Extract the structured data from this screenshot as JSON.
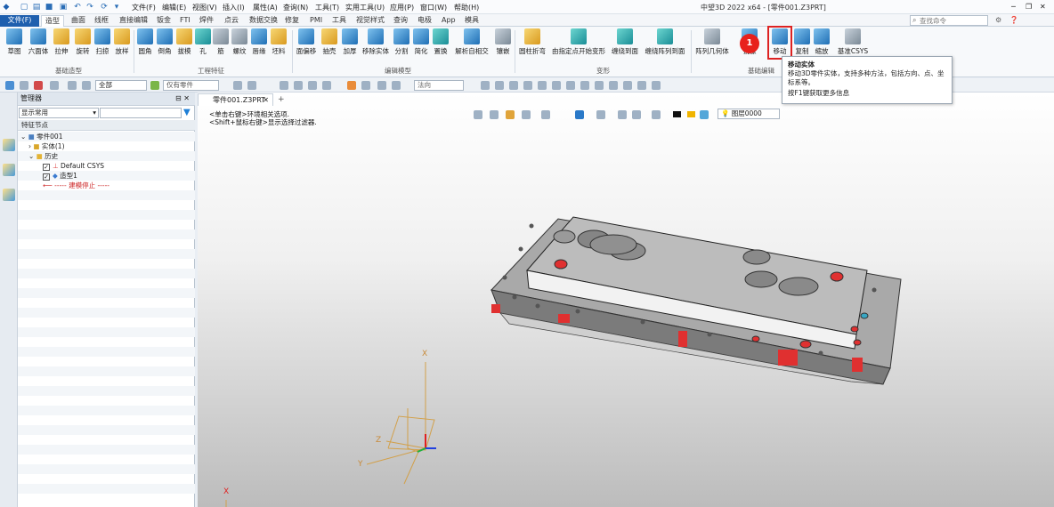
{
  "window": {
    "title": "中望3D 2022 x64 - [零件001.Z3PRT]"
  },
  "menu": [
    "文件(F)",
    "编辑(E)",
    "视图(V)",
    "插入(I)",
    "属性(A)",
    "查询(N)",
    "工具(T)",
    "实用工具(U)",
    "应用(P)",
    "窗口(W)",
    "帮助(H)"
  ],
  "search": {
    "placeholder": "查找命令"
  },
  "ribbon_tabs": [
    "文件(F)",
    "造型",
    "曲面",
    "线框",
    "直接编辑",
    "钣金",
    "FTI",
    "焊件",
    "点云",
    "数据交换",
    "修复",
    "PMI",
    "工具",
    "视觉样式",
    "查询",
    "电极",
    "App",
    "模具"
  ],
  "ribbon": {
    "buttons": [
      "草图",
      "六面体",
      "拉伸",
      "旋转",
      "扫掠",
      "放样",
      "圆角",
      "倒角",
      "拔模",
      "孔",
      "筋",
      "螺纹",
      "唇缘",
      "坯料",
      "面偏移",
      "抽壳",
      "加厚",
      "移除实体",
      "分割",
      "简化",
      "置换",
      "解析自相交",
      "镶嵌",
      "圆柱折弯",
      "由指定点开始变形",
      "缠绕到面",
      "缠绕阵列到面",
      "阵列几何体",
      "镜像",
      "移动",
      "复制",
      "缩放",
      "基准CSYS"
    ],
    "groups": [
      "基础造型",
      "工程特征",
      "编辑模型",
      "变形",
      "基础编辑"
    ]
  },
  "toolbar": {
    "filter_all": "全部",
    "filter_part": "仅有零件",
    "normal": "法向"
  },
  "manager": {
    "title": "管理器",
    "filter": "显示常用",
    "column": "特征节点",
    "tree": [
      "零件001",
      "实体(1)",
      "历史",
      "Default CSYS",
      "造型1",
      "----- 建模停止 -----"
    ]
  },
  "document": {
    "tab": "零件001.Z3PRT"
  },
  "hints": [
    "<单击右键>环境相关选项.",
    "<Shift+鼠标右键>显示选择过滤器."
  ],
  "view_toolbar": {
    "layer": "图层0000"
  },
  "tooltip": {
    "title": "移动实体",
    "body": "移动3D零件实体，支持多种方法，包括方向、点、坐标系等。",
    "help": "按F1键获取更多信息"
  },
  "badge": "1",
  "axes": {
    "x": "X",
    "y": "Y",
    "z": "Z",
    "x2": "X"
  },
  "colors": {
    "accent": "#1e5fae",
    "highlight": "#d22222",
    "part": "#9a9a9a",
    "hole": "#e03030"
  }
}
